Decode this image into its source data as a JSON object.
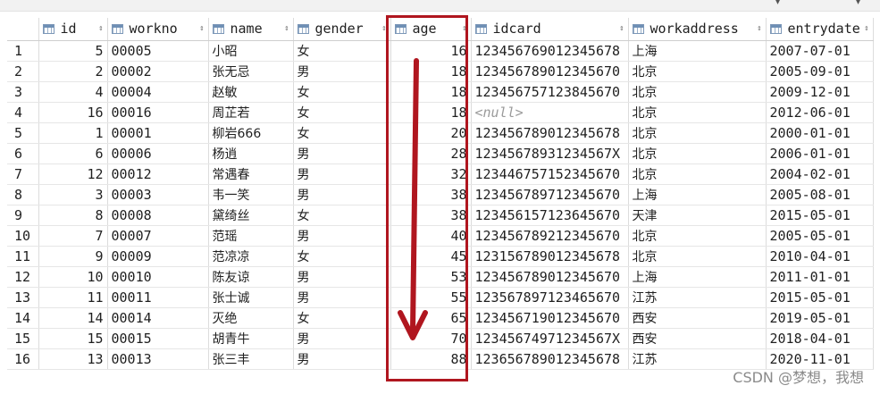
{
  "columns": [
    {
      "key": "rownum",
      "label": ""
    },
    {
      "key": "id",
      "label": "id"
    },
    {
      "key": "workno",
      "label": "workno"
    },
    {
      "key": "name",
      "label": "name"
    },
    {
      "key": "gender",
      "label": "gender"
    },
    {
      "key": "age",
      "label": "age"
    },
    {
      "key": "idcard",
      "label": "idcard"
    },
    {
      "key": "workaddress",
      "label": "workaddress"
    },
    {
      "key": "entrydate",
      "label": "entrydate"
    }
  ],
  "rows": [
    {
      "rownum": "1",
      "id": "5",
      "workno": "00005",
      "name": "小昭",
      "gender": "女",
      "age": "16",
      "idcard": "123456769012345678",
      "workaddress": "上海",
      "entrydate": "2007-07-01"
    },
    {
      "rownum": "2",
      "id": "2",
      "workno": "00002",
      "name": "张无忌",
      "gender": "男",
      "age": "18",
      "idcard": "123456789012345670",
      "workaddress": "北京",
      "entrydate": "2005-09-01"
    },
    {
      "rownum": "3",
      "id": "4",
      "workno": "00004",
      "name": "赵敏",
      "gender": "女",
      "age": "18",
      "idcard": "123456757123845670",
      "workaddress": "北京",
      "entrydate": "2009-12-01"
    },
    {
      "rownum": "4",
      "id": "16",
      "workno": "00016",
      "name": "周芷若",
      "gender": "女",
      "age": "18",
      "idcard": "<null>",
      "workaddress": "北京",
      "entrydate": "2012-06-01"
    },
    {
      "rownum": "5",
      "id": "1",
      "workno": "00001",
      "name": "柳岩666",
      "gender": "女",
      "age": "20",
      "idcard": "123456789012345678",
      "workaddress": "北京",
      "entrydate": "2000-01-01"
    },
    {
      "rownum": "6",
      "id": "6",
      "workno": "00006",
      "name": "杨逍",
      "gender": "男",
      "age": "28",
      "idcard": "12345678931234567X",
      "workaddress": "北京",
      "entrydate": "2006-01-01"
    },
    {
      "rownum": "7",
      "id": "12",
      "workno": "00012",
      "name": "常遇春",
      "gender": "男",
      "age": "32",
      "idcard": "123446757152345670",
      "workaddress": "北京",
      "entrydate": "2004-02-01"
    },
    {
      "rownum": "8",
      "id": "3",
      "workno": "00003",
      "name": "韦一笑",
      "gender": "男",
      "age": "38",
      "idcard": "123456789712345670",
      "workaddress": "上海",
      "entrydate": "2005-08-01"
    },
    {
      "rownum": "9",
      "id": "8",
      "workno": "00008",
      "name": "黛绮丝",
      "gender": "女",
      "age": "38",
      "idcard": "123456157123645670",
      "workaddress": "天津",
      "entrydate": "2015-05-01"
    },
    {
      "rownum": "10",
      "id": "7",
      "workno": "00007",
      "name": "范瑶",
      "gender": "男",
      "age": "40",
      "idcard": "123456789212345670",
      "workaddress": "北京",
      "entrydate": "2005-05-01"
    },
    {
      "rownum": "11",
      "id": "9",
      "workno": "00009",
      "name": "范凉凉",
      "gender": "女",
      "age": "45",
      "idcard": "123156789012345678",
      "workaddress": "北京",
      "entrydate": "2010-04-01"
    },
    {
      "rownum": "12",
      "id": "10",
      "workno": "00010",
      "name": "陈友谅",
      "gender": "男",
      "age": "53",
      "idcard": "123456789012345670",
      "workaddress": "上海",
      "entrydate": "2011-01-01"
    },
    {
      "rownum": "13",
      "id": "11",
      "workno": "00011",
      "name": "张士诚",
      "gender": "男",
      "age": "55",
      "idcard": "123567897123465670",
      "workaddress": "江苏",
      "entrydate": "2015-05-01"
    },
    {
      "rownum": "14",
      "id": "14",
      "workno": "00014",
      "name": "灭绝",
      "gender": "女",
      "age": "65",
      "idcard": "123456719012345670",
      "workaddress": "西安",
      "entrydate": "2019-05-01"
    },
    {
      "rownum": "15",
      "id": "15",
      "workno": "00015",
      "name": "胡青牛",
      "gender": "男",
      "age": "70",
      "idcard": "12345674971234567X",
      "workaddress": "西安",
      "entrydate": "2018-04-01"
    },
    {
      "rownum": "16",
      "id": "13",
      "workno": "00013",
      "name": "张三丰",
      "gender": "男",
      "age": "88",
      "idcard": "123656789012345678",
      "workaddress": "江苏",
      "entrydate": "2020-11-01"
    }
  ],
  "watermark": "CSDN @梦想，我想",
  "colors": {
    "highlight": "#b0161f",
    "null_text": "#9a9a9a"
  }
}
